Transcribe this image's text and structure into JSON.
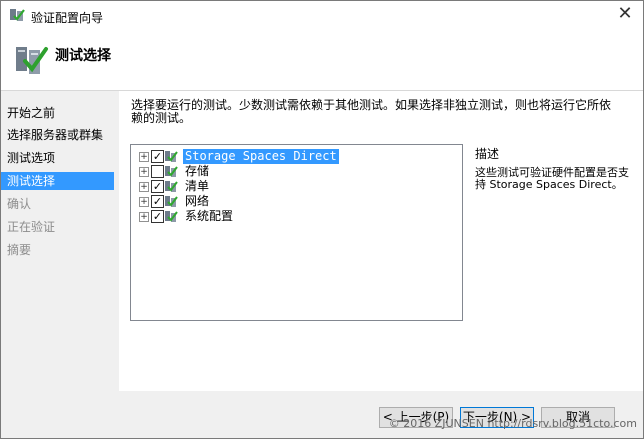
{
  "window": {
    "title": "验证配置向导"
  },
  "header": {
    "title": "测试选择"
  },
  "nav": {
    "items": [
      {
        "label": "开始之前",
        "state": "normal"
      },
      {
        "label": "选择服务器或群集",
        "state": "normal"
      },
      {
        "label": "测试选项",
        "state": "normal"
      },
      {
        "label": "测试选择",
        "state": "active"
      },
      {
        "label": "确认",
        "state": "disabled"
      },
      {
        "label": "正在验证",
        "state": "disabled"
      },
      {
        "label": "摘要",
        "state": "disabled"
      }
    ]
  },
  "main": {
    "instructions": "选择要运行的测试。少数测试需依赖于其他测试。如果选择非独立测试，则也将运行它所依赖的测试。",
    "tree": [
      {
        "label": "Storage Spaces Direct",
        "checked": true,
        "selected": true
      },
      {
        "label": "存储",
        "checked": false,
        "selected": false
      },
      {
        "label": "清单",
        "checked": true,
        "selected": false
      },
      {
        "label": "网络",
        "checked": true,
        "selected": false
      },
      {
        "label": "系统配置",
        "checked": true,
        "selected": false
      }
    ],
    "description": {
      "title": "描述",
      "body": "这些测试可验证硬件配置是否支持 Storage Spaces Direct。"
    }
  },
  "footer": {
    "prev_label": "< 上一步(P)",
    "next_label": "下一步(N) >",
    "cancel_label": "取消"
  },
  "watermark": "© 2016 ZJUNSEN http://rdsrv.blog.51cto.com"
}
